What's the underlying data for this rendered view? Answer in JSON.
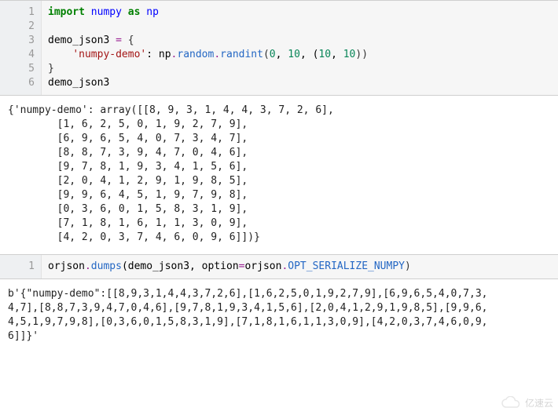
{
  "cell1": {
    "line_numbers": [
      "1",
      "2",
      "3",
      "4",
      "5",
      "6"
    ],
    "tokens": {
      "l1": {
        "t1": "import",
        "t2": "numpy",
        "t3": "as",
        "t4": "np"
      },
      "l3": {
        "t1": "demo_json3",
        "t2": "=",
        "t3": "{"
      },
      "l4": {
        "t1": "    ",
        "t2": "'numpy-demo'",
        "t3": ": ",
        "t4": "np",
        "t5": ".",
        "t6": "random",
        "t7": ".",
        "t8": "randint",
        "t9": "(",
        "t10": "0",
        "t11": ", ",
        "t12": "10",
        "t13": ", (",
        "t14": "10",
        "t15": ", ",
        "t16": "10",
        "t17": "))"
      },
      "l5": {
        "t1": "}"
      },
      "l6": {
        "t1": "demo_json3"
      }
    }
  },
  "output1": "{'numpy-demo': array([[8, 9, 3, 1, 4, 4, 3, 7, 2, 6],\n        [1, 6, 2, 5, 0, 1, 9, 2, 7, 9],\n        [6, 9, 6, 5, 4, 0, 7, 3, 4, 7],\n        [8, 8, 7, 3, 9, 4, 7, 0, 4, 6],\n        [9, 7, 8, 1, 9, 3, 4, 1, 5, 6],\n        [2, 0, 4, 1, 2, 9, 1, 9, 8, 5],\n        [9, 9, 6, 4, 5, 1, 9, 7, 9, 8],\n        [0, 3, 6, 0, 1, 5, 8, 3, 1, 9],\n        [7, 1, 8, 1, 6, 1, 1, 3, 0, 9],\n        [4, 2, 0, 3, 7, 4, 6, 0, 9, 6]])}",
  "cell2": {
    "line_numbers": [
      "1"
    ],
    "tokens": {
      "l1": {
        "t1": "orjson",
        "t2": ".",
        "t3": "dumps",
        "t4": "(demo_json3, option",
        "t5": "=",
        "t6": "orjson",
        "t7": ".",
        "t8": "OPT_SERIALIZE_NUMPY",
        "t9": ")"
      }
    }
  },
  "output2": "b'{\"numpy-demo\":[[8,9,3,1,4,4,3,7,2,6],[1,6,2,5,0,1,9,2,7,9],[6,9,6,5,4,0,7,3,\n4,7],[8,8,7,3,9,4,7,0,4,6],[9,7,8,1,9,3,4,1,5,6],[2,0,4,1,2,9,1,9,8,5],[9,9,6,\n4,5,1,9,7,9,8],[0,3,6,0,1,5,8,3,1,9],[7,1,8,1,6,1,1,3,0,9],[4,2,0,3,7,4,6,0,9,\n6]]}'",
  "watermark": {
    "text": "亿速云"
  }
}
